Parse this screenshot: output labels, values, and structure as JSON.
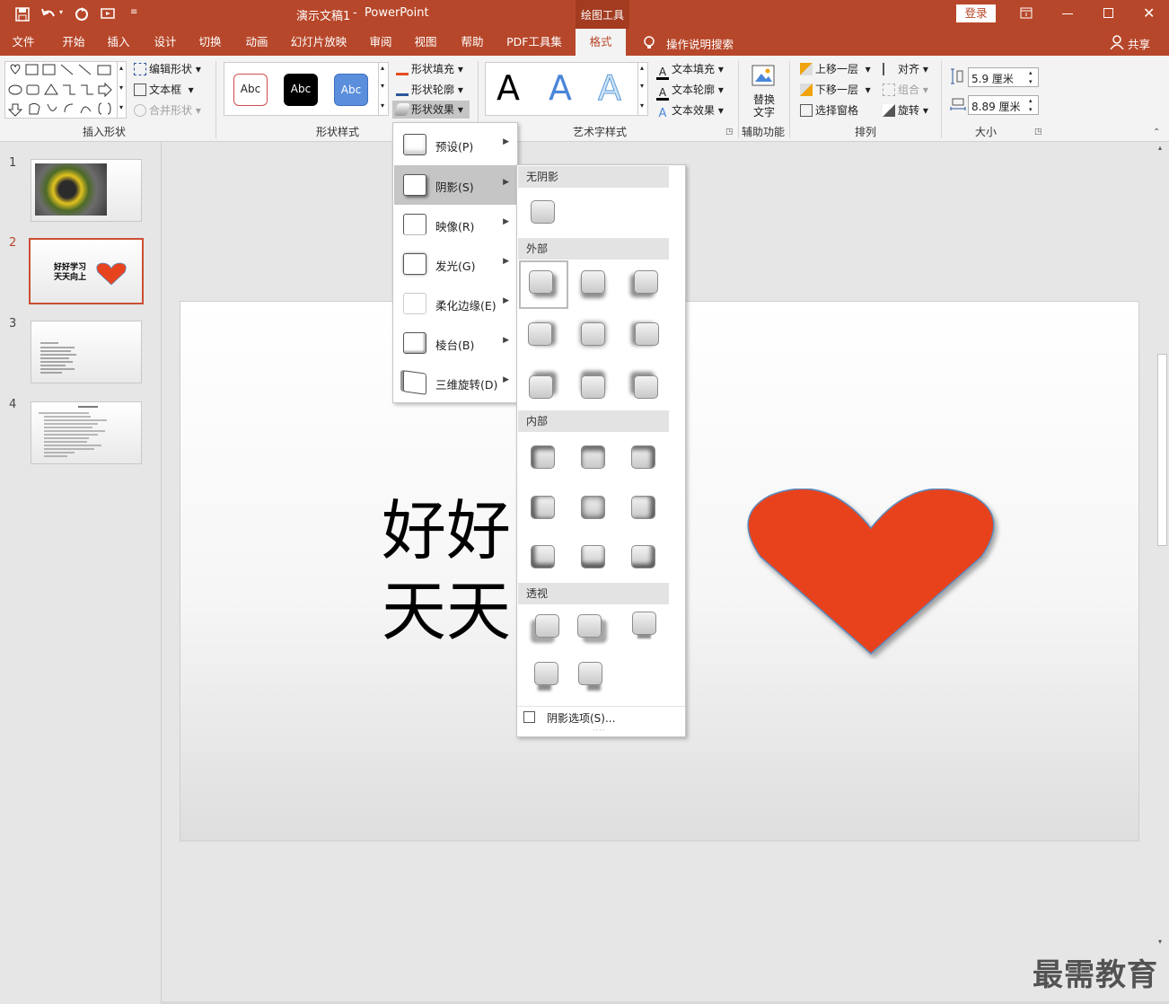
{
  "titlebar": {
    "doc_title": "演示文稿1",
    "separator": "-",
    "app_name": "PowerPoint",
    "context_tab": "绘图工具",
    "login": "登录"
  },
  "tabs": [
    "文件",
    "开始",
    "插入",
    "设计",
    "切换",
    "动画",
    "幻灯片放映",
    "审阅",
    "视图",
    "帮助",
    "PDF工具集",
    "格式"
  ],
  "active_tab": "格式",
  "tell_me": "操作说明搜索",
  "share": "共享",
  "ribbon": {
    "insert_shapes": {
      "label": "插入形状",
      "edit_shape": "编辑形状",
      "textbox": "文本框",
      "merge_shapes": "合并形状"
    },
    "shape_styles": {
      "label": "形状样式",
      "abc": "Abc",
      "fill": "形状填充",
      "outline": "形状轮廓",
      "effects": "形状效果"
    },
    "wordart": {
      "label": "艺术字样式",
      "letter": "A",
      "text_fill": "文本填充",
      "text_outline": "文本轮廓",
      "text_effects": "文本效果"
    },
    "accessibility": {
      "label": "辅助功能",
      "alt_text_1": "替换",
      "alt_text_2": "文字"
    },
    "arrange": {
      "label": "排列",
      "bring_forward": "上移一层",
      "send_backward": "下移一层",
      "selection_pane": "选择窗格",
      "align": "对齐",
      "group": "组合",
      "rotate": "旋转"
    },
    "size": {
      "label": "大小",
      "height": "5.9 厘米",
      "width": "8.89 厘米"
    }
  },
  "slides": [
    {
      "num": "1"
    },
    {
      "num": "2",
      "line1": "好好学习",
      "line2": "天天向上"
    },
    {
      "num": "3"
    },
    {
      "num": "4"
    }
  ],
  "slide_text": {
    "line1": "好好",
    "line2": "天天"
  },
  "effects_menu": [
    "预设(P)",
    "阴影(S)",
    "映像(R)",
    "发光(G)",
    "柔化边缘(E)",
    "棱台(B)",
    "三维旋转(D)"
  ],
  "shadow_menu": {
    "no_shadow": "无阴影",
    "outer": "外部",
    "inner": "内部",
    "perspective": "透视",
    "options": "阴影选项(S)..."
  },
  "colors": {
    "accent": "#b7472a",
    "heart": "#e8431f",
    "heart_outline": "#5b8cc0"
  },
  "watermark": "最需教育"
}
